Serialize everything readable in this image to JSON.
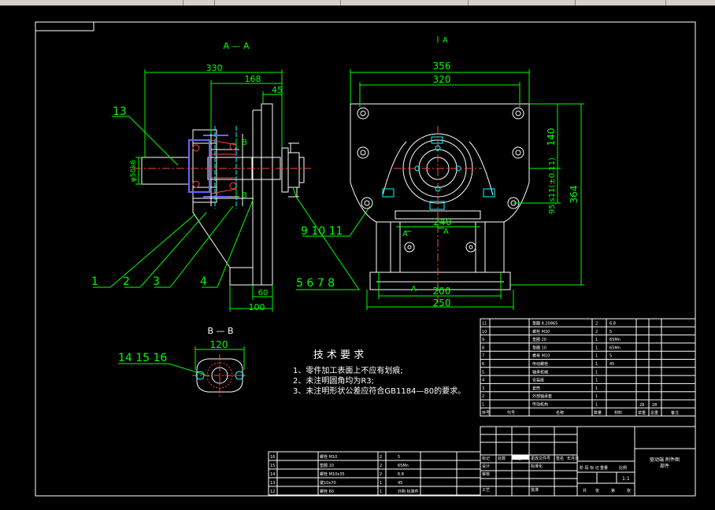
{
  "colors": {
    "background": "#000000",
    "outline": "#ffffff",
    "dimension": "#00ff00",
    "accent": "#00ffff",
    "hidden": "#ff4444",
    "marker": "#6666ff"
  },
  "section_aa": {
    "title": "A — A",
    "dim_330": "330",
    "dim_168": "168",
    "dim_45": "45",
    "dim_60": "60",
    "dim_100": "100",
    "shaft_dia": "φ50k6"
  },
  "front_view": {
    "dim_356": "356",
    "dim_320": "320",
    "dim_240": "240",
    "dim_200": "200",
    "dim_250": "250",
    "dim_364": "364",
    "dim_140": "140",
    "dim_95": "95js11(±0.11)",
    "label_a_top": "A",
    "label_a_mid_left": "A",
    "label_a_mid_right": "A",
    "label_a_bottom": "A",
    "label_b_top": "B",
    "label_b_bottom": "B"
  },
  "balloons": {
    "b13": "13",
    "b9_11": "9 10 11",
    "b1": "1",
    "b2": "2",
    "b3": "3",
    "b4": "4",
    "b5_8": "5  6  7  8",
    "b14_16": "14 15 16"
  },
  "section_bb": {
    "title": "B — B",
    "dim_120": "120"
  },
  "tech": {
    "heading": "技 术 要 求",
    "line1": "1、零件加工表面上不应有划痕;",
    "line2": "2、未注明圆角均为R3;",
    "line3": "3、未注明形状公差应符合GB1184—80的要求。"
  },
  "parts_right": [
    {
      "no": "11",
      "name": "垫圈 8.20865",
      "qty": "2",
      "mat": "6.8"
    },
    {
      "no": "10",
      "name": "螺栓 M30",
      "qty": "2",
      "mat": "5"
    },
    {
      "no": "9",
      "name": "垫圈 20",
      "qty": "1",
      "mat": "65Mn"
    },
    {
      "no": "8",
      "name": "垫圈 10",
      "qty": "1",
      "mat": "65Mn"
    },
    {
      "no": "7",
      "name": "螺母 M10",
      "qty": "1",
      "mat": "5"
    },
    {
      "no": "6",
      "name": "传动螺栓",
      "qty": "1",
      "mat": "45"
    },
    {
      "no": "5",
      "name": "轴承机械",
      "qty": "1",
      "mat": ""
    },
    {
      "no": "4",
      "name": "安装座",
      "qty": "1",
      "mat": ""
    },
    {
      "no": "3",
      "name": "套筒",
      "qty": "1",
      "mat": ""
    },
    {
      "no": "2",
      "name": "外部轴承套",
      "qty": "1",
      "mat": ""
    },
    {
      "no": "1",
      "name": "传动机构",
      "qty": "1",
      "mat": ""
    }
  ],
  "parts_right_header": {
    "c1": "序号",
    "c2": "代号",
    "c3": "名称",
    "c4": "数量",
    "c5": "材料",
    "c6": "单重",
    "c7": "总重",
    "c8": "备注"
  },
  "parts_right_extra": {
    "w1": "28",
    "w2": "28"
  },
  "parts_left": [
    {
      "no": "16",
      "name": "螺栓 M10",
      "qty": "2",
      "mat": "5"
    },
    {
      "no": "15",
      "name": "垫圈 10",
      "qty": "2",
      "mat": "65Mn"
    },
    {
      "no": "14",
      "name": "螺栓 M10x35",
      "qty": "2",
      "mat": "6.8"
    },
    {
      "no": "13",
      "name": "键10x70",
      "qty": "1",
      "mat": "45"
    },
    {
      "no": "12",
      "name": "螺栓 60",
      "qty": "1",
      "mat": "外购 标准件"
    }
  ],
  "title_block": {
    "title": "驱动端 附件图",
    "sub": "部件",
    "scale": "1:1",
    "sheet_a": "共",
    "sheet_b": "张",
    "sheet_c": "第",
    "sheet_d": "张",
    "l_design": "设计",
    "l_std": "标准化",
    "l_check": "审核",
    "l_craft": "工艺",
    "l_approve": "批准",
    "l_mark": "标记",
    "l_count": "处数",
    "l_zone": "分区",
    "l_doc": "更改文件号",
    "l_sign": "签名",
    "l_date": "年月日",
    "l_stage": "阶 段 标 记",
    "l_weight": "重量",
    "l_ratio": "比例"
  }
}
